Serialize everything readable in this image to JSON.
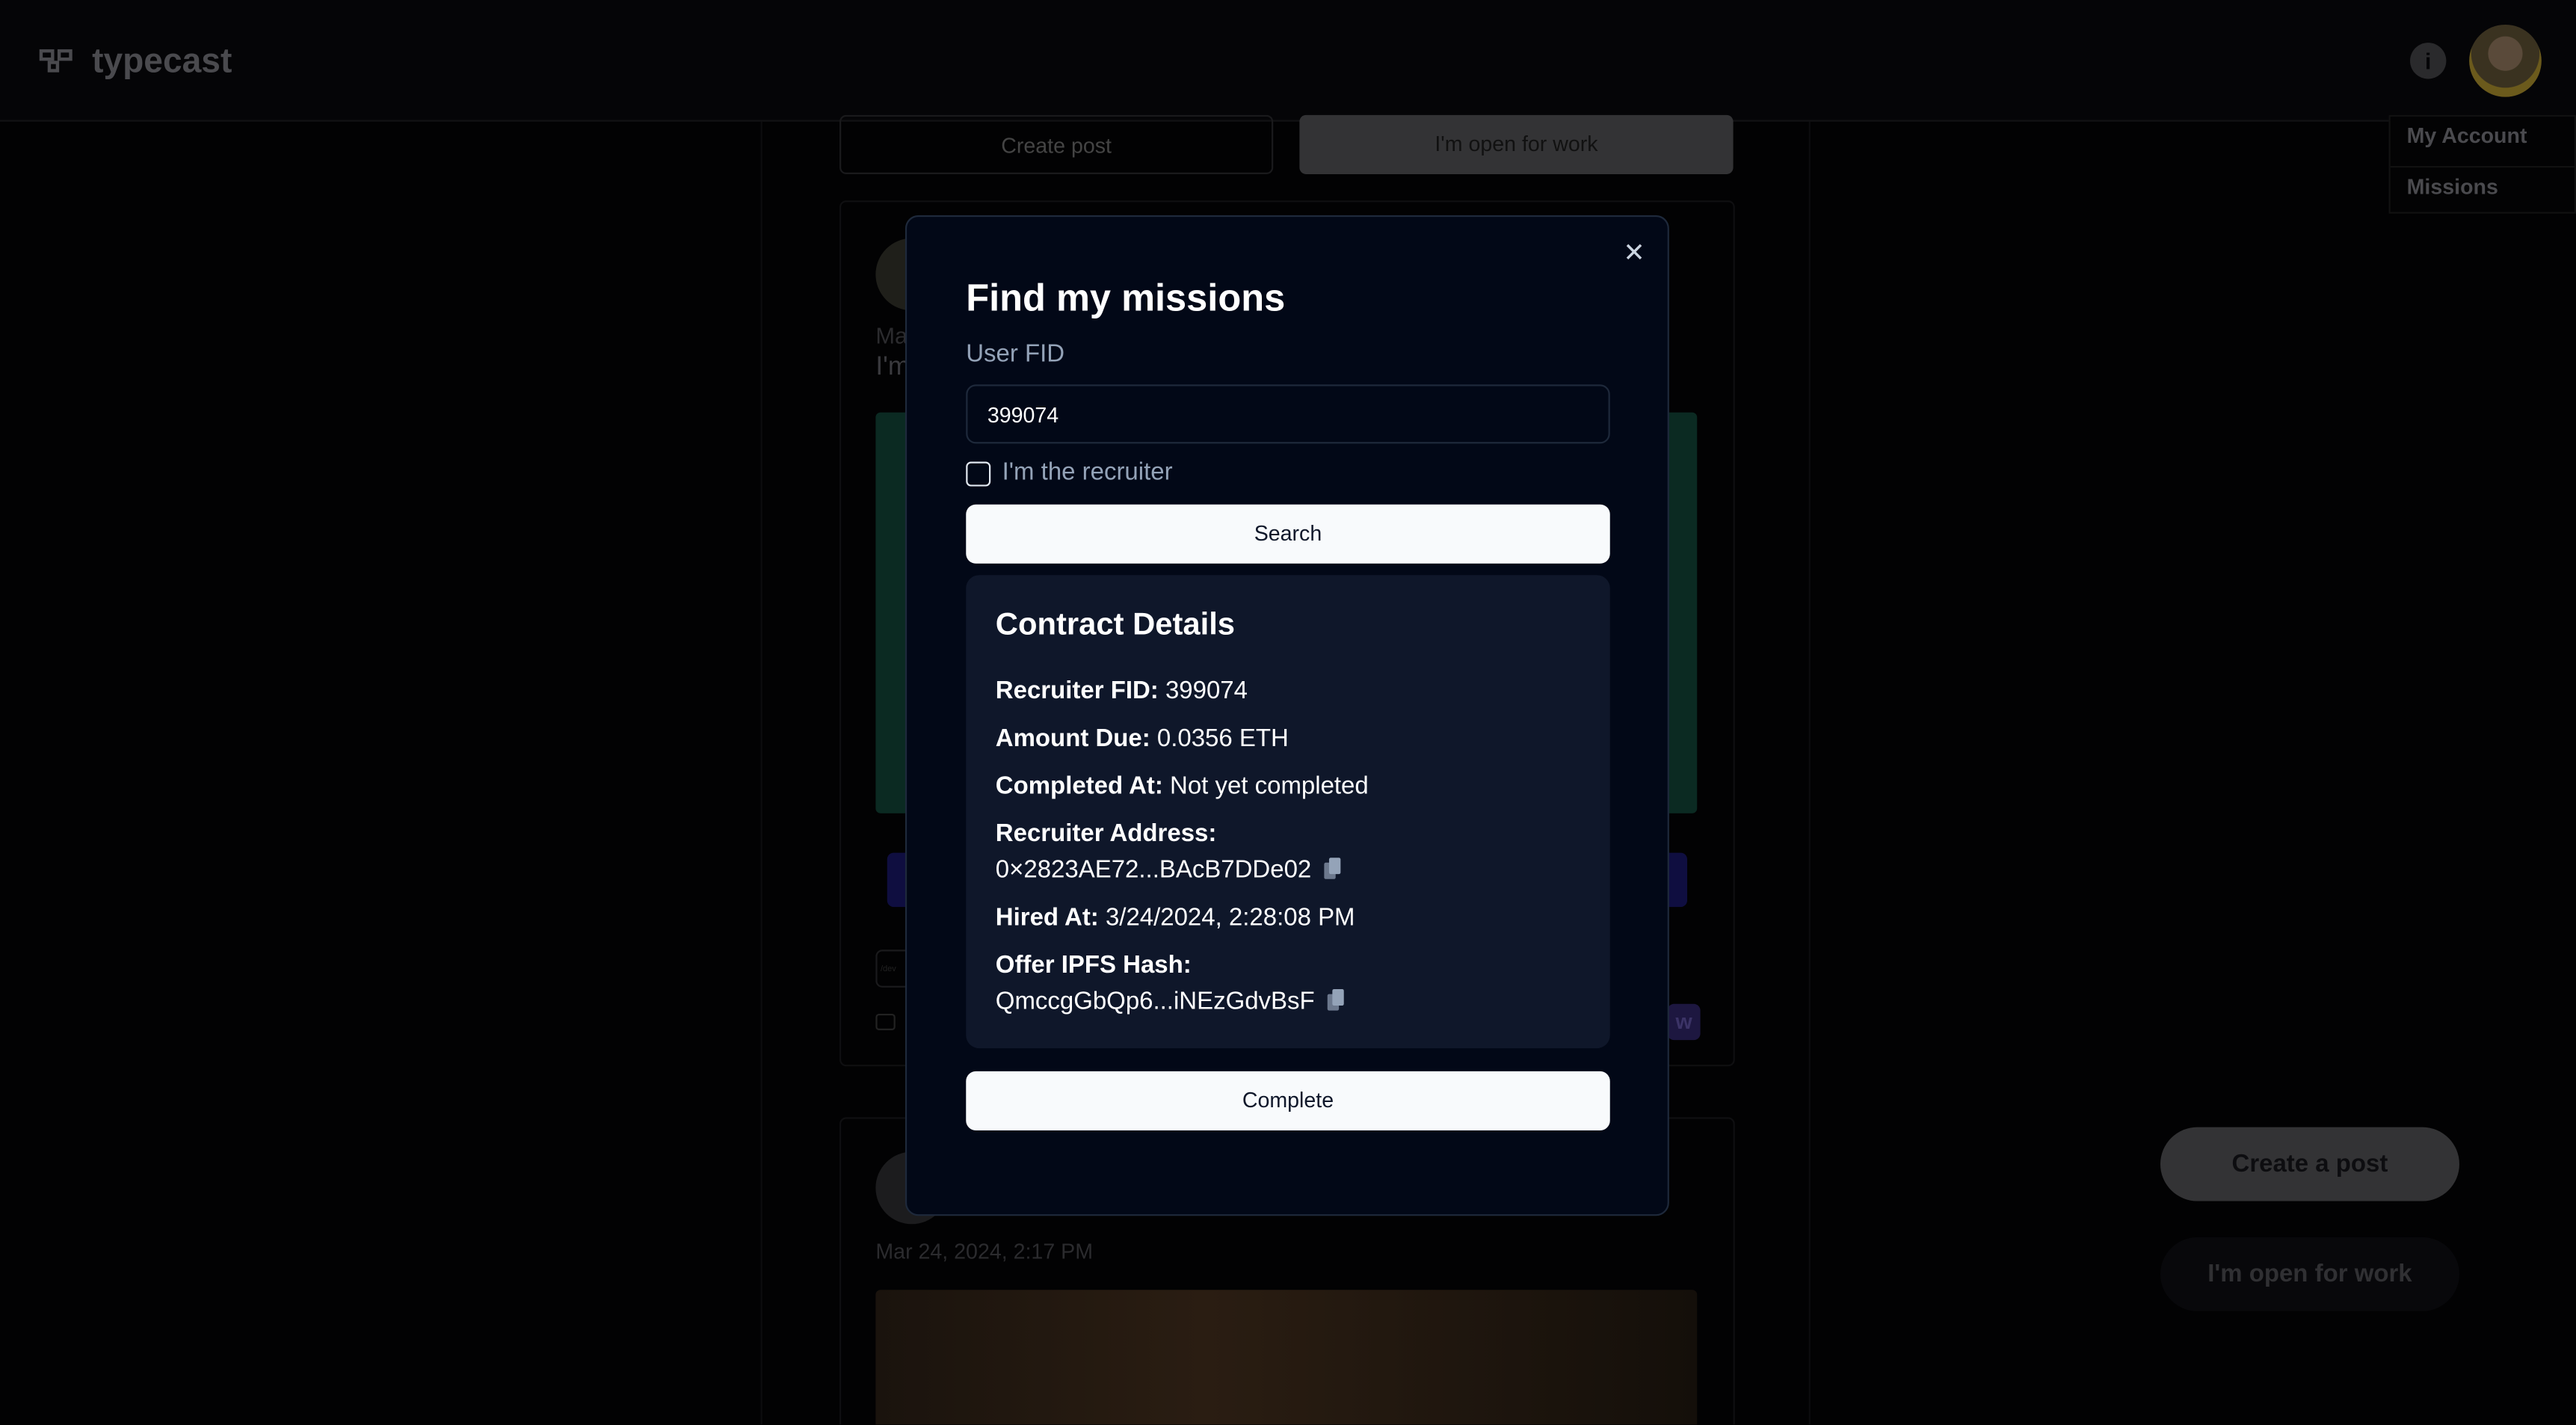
{
  "header": {
    "brand": "typecast",
    "menu": [
      "My Account",
      "Missions"
    ]
  },
  "feed": {
    "create_post": "Create post",
    "open_for_work": "I'm open for work",
    "post1": {
      "author_partial": "Ma",
      "text_partial": "I'm",
      "tag_partial": "/dev",
      "badge_partial": "w"
    },
    "post2": {
      "date": "Mar 24, 2024, 2:17 PM"
    }
  },
  "fab": {
    "create": "Create a post",
    "open": "I'm open for work"
  },
  "modal": {
    "title": "Find my missions",
    "fid_label": "User FID",
    "fid_value": "399074",
    "recruiter_label": "I'm the recruiter",
    "recruiter_checked": false,
    "search": "Search",
    "details": {
      "title": "Contract Details",
      "recruiter_fid_label": "Recruiter FID:",
      "recruiter_fid": "399074",
      "amount_label": "Amount Due:",
      "amount": "0.0356 ETH",
      "completed_label": "Completed At:",
      "completed": "Not yet completed",
      "address_label": "Recruiter Address:",
      "address": "0×2823AE72...BAcB7DDe02",
      "hired_label": "Hired At:",
      "hired": "3/24/2024, 2:28:08 PM",
      "ipfs_label": "Offer IPFS Hash:",
      "ipfs": "QmccgGbQp6...iNEzGdvBsF"
    },
    "complete": "Complete"
  }
}
